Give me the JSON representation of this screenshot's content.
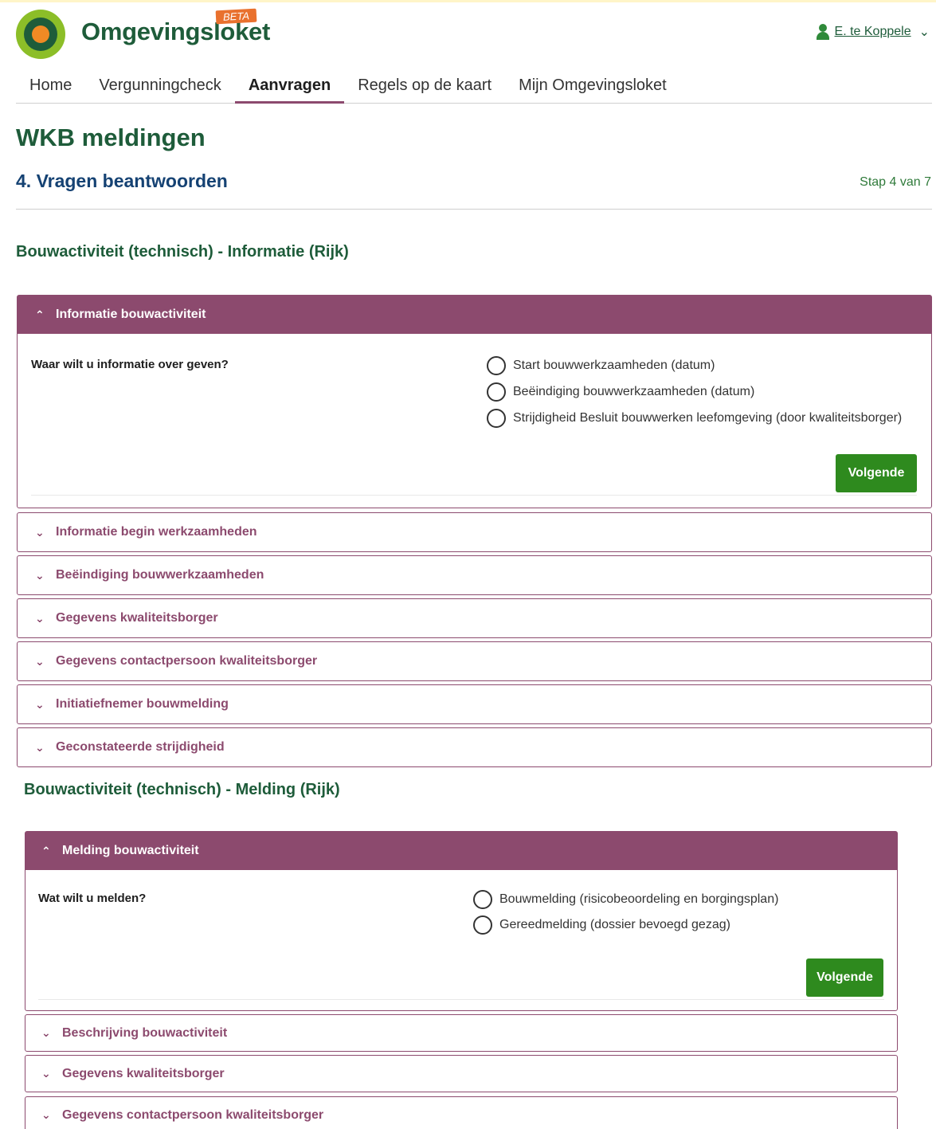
{
  "header": {
    "brand": "Omgevingsloket",
    "beta": "BETA",
    "user_name": "E. te Koppele",
    "user_icon": "person-icon",
    "chevron": "chevron-down-icon"
  },
  "nav": {
    "tabs": [
      {
        "label": "Home"
      },
      {
        "label": "Vergunningcheck"
      },
      {
        "label": "Aanvragen"
      },
      {
        "label": "Regels op de kaart"
      },
      {
        "label": "Mijn Omgevingsloket"
      }
    ],
    "active": "Aanvragen"
  },
  "page": {
    "title": "WKB meldingen",
    "subtitle": "4. Vragen beantwoorden",
    "step": "Stap 4 van 7"
  },
  "section1": {
    "title": "Bouwactiviteit (technisch) - Informatie (Rijk)",
    "open_panel": {
      "label": "Informatie bouwactiviteit",
      "question": "Waar wilt u informatie over geven?",
      "options": [
        "Start bouwwerkzaamheden (datum)",
        "Beëindiging bouwwerkzaamheden (datum)",
        "Strijdigheid Besluit bouwwerken leefomgeving (door kwaliteitsborger)"
      ],
      "button": "Volgende"
    },
    "panels": [
      "Informatie begin werkzaamheden",
      "Beëindiging bouwwerkzaamheden",
      "Gegevens kwaliteitsborger",
      "Gegevens contactpersoon kwaliteitsborger",
      "Initiatiefnemer bouwmelding",
      "Geconstateerde strijdigheid"
    ]
  },
  "section2": {
    "title": "Bouwactiviteit (technisch) - Melding (Rijk)",
    "open_panel": {
      "label": "Melding bouwactiviteit",
      "question": "Wat wilt u melden?",
      "options": [
        "Bouwmelding (risicobeoordeling en borgingsplan)",
        "Gereedmelding (dossier bevoegd gezag)"
      ],
      "button": "Volgende"
    },
    "panels": [
      "Beschrijving bouwactiviteit",
      "Gegevens kwaliteitsborger",
      "Gegevens contactpersoon kwaliteitsborger"
    ]
  },
  "colors": {
    "brand_green": "#1e5c3a",
    "accent_purple": "#8c4a6e",
    "button_green": "#2e8a1e",
    "beta_orange": "#e9712e"
  }
}
